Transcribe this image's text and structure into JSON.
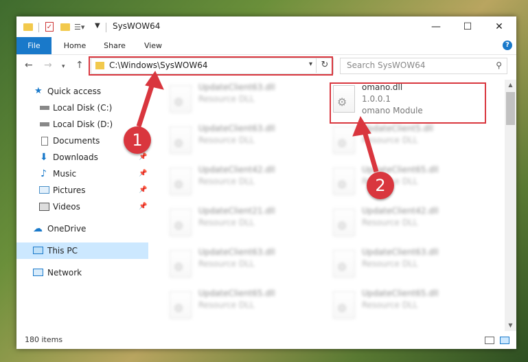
{
  "window": {
    "title": "SysWOW64"
  },
  "ribbon": {
    "tabs": [
      "File",
      "Home",
      "Share",
      "View"
    ],
    "help": "?"
  },
  "nav": {
    "address": "C:\\Windows\\SysWOW64",
    "search_placeholder": "Search SysWOW64"
  },
  "sidebar": {
    "items": [
      {
        "label": "Quick access",
        "icon": "star-icon"
      },
      {
        "label": "Local Disk (C:)",
        "icon": "drive-icon"
      },
      {
        "label": "Local Disk (D:)",
        "icon": "drive-icon"
      },
      {
        "label": "Documents",
        "icon": "documents-icon"
      },
      {
        "label": "Downloads",
        "icon": "download-icon"
      },
      {
        "label": "Music",
        "icon": "music-icon"
      },
      {
        "label": "Pictures",
        "icon": "pictures-icon"
      },
      {
        "label": "Videos",
        "icon": "videos-icon"
      },
      {
        "label": "OneDrive",
        "icon": "cloud-icon"
      },
      {
        "label": "This PC",
        "icon": "computer-icon"
      },
      {
        "label": "Network",
        "icon": "network-icon"
      }
    ]
  },
  "files": {
    "highlighted": {
      "name": "omano.dll",
      "version": "1.0.0.1",
      "description": "omano Module"
    },
    "left_column": [
      {
        "name": "UpdateClient63.dll",
        "type": "Resource DLL"
      },
      {
        "name": "UpdateClient63.dll",
        "type": "Resource DLL"
      },
      {
        "name": "UpdateClient42.dll",
        "type": "Resource DLL"
      },
      {
        "name": "UpdateClient21.dll",
        "type": "Resource DLL"
      },
      {
        "name": "UpdateClient63.dll",
        "type": "Resource DLL"
      },
      {
        "name": "UpdateClient65.dll",
        "type": "Resource DLL"
      }
    ],
    "right_column": [
      {
        "name": "UpdateClient5.dll",
        "type": "Resource DLL"
      },
      {
        "name": "UpdateClient65.dll",
        "type": "Resource DLL"
      },
      {
        "name": "UpdateClient42.dll",
        "type": "Resource DLL"
      },
      {
        "name": "UpdateClient63.dll",
        "type": "Resource DLL"
      },
      {
        "name": "UpdateClient65.dll",
        "type": "Resource DLL"
      }
    ]
  },
  "status": {
    "item_count": "180 items"
  },
  "annotations": {
    "step1": "1",
    "step2": "2",
    "color": "#d9363e"
  }
}
